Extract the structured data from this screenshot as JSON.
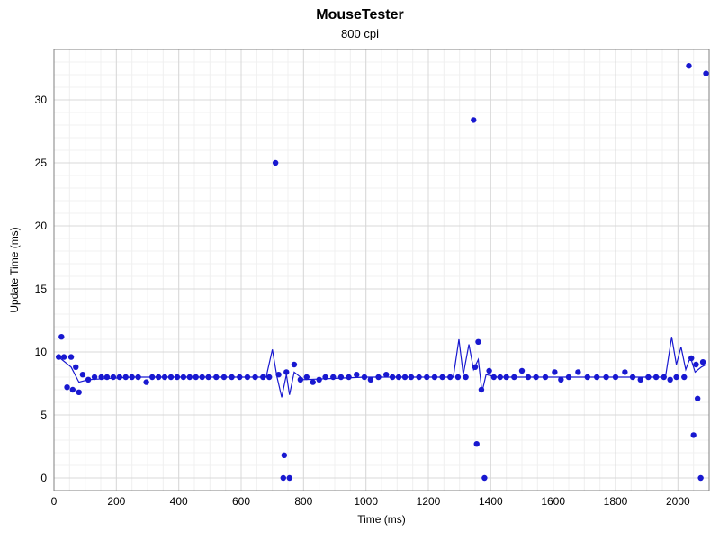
{
  "chart_data": {
    "type": "scatter",
    "title": "MouseTester",
    "subtitle": "800 cpi",
    "xlabel": "Time (ms)",
    "ylabel": "Update Time (ms)",
    "xlim": [
      0,
      2100
    ],
    "ylim": [
      -1,
      34
    ],
    "x_ticks": [
      0,
      200,
      400,
      600,
      800,
      1000,
      1200,
      1400,
      1600,
      1800,
      2000
    ],
    "y_ticks": [
      0,
      5,
      10,
      15,
      20,
      25,
      30
    ],
    "series": [
      {
        "name": "Update Time",
        "color": "#1818d0",
        "points": [
          {
            "x": 15,
            "y": 9.6
          },
          {
            "x": 24,
            "y": 11.2
          },
          {
            "x": 32,
            "y": 9.6
          },
          {
            "x": 42,
            "y": 7.2
          },
          {
            "x": 55,
            "y": 9.6
          },
          {
            "x": 60,
            "y": 7.0
          },
          {
            "x": 70,
            "y": 8.8
          },
          {
            "x": 80,
            "y": 6.8
          },
          {
            "x": 92,
            "y": 8.2
          },
          {
            "x": 110,
            "y": 7.8
          },
          {
            "x": 130,
            "y": 8.0
          },
          {
            "x": 152,
            "y": 8.0
          },
          {
            "x": 170,
            "y": 8.0
          },
          {
            "x": 190,
            "y": 8.0
          },
          {
            "x": 210,
            "y": 8.0
          },
          {
            "x": 230,
            "y": 8.0
          },
          {
            "x": 250,
            "y": 8.0
          },
          {
            "x": 270,
            "y": 8.0
          },
          {
            "x": 296,
            "y": 7.6
          },
          {
            "x": 315,
            "y": 8.0
          },
          {
            "x": 335,
            "y": 8.0
          },
          {
            "x": 355,
            "y": 8.0
          },
          {
            "x": 375,
            "y": 8.0
          },
          {
            "x": 395,
            "y": 8.0
          },
          {
            "x": 415,
            "y": 8.0
          },
          {
            "x": 435,
            "y": 8.0
          },
          {
            "x": 455,
            "y": 8.0
          },
          {
            "x": 475,
            "y": 8.0
          },
          {
            "x": 495,
            "y": 8.0
          },
          {
            "x": 520,
            "y": 8.0
          },
          {
            "x": 545,
            "y": 8.0
          },
          {
            "x": 570,
            "y": 8.0
          },
          {
            "x": 595,
            "y": 8.0
          },
          {
            "x": 620,
            "y": 8.0
          },
          {
            "x": 645,
            "y": 8.0
          },
          {
            "x": 670,
            "y": 8.0
          },
          {
            "x": 690,
            "y": 8.0
          },
          {
            "x": 710,
            "y": 25.0
          },
          {
            "x": 720,
            "y": 8.2
          },
          {
            "x": 735,
            "y": 0.0
          },
          {
            "x": 738,
            "y": 1.8
          },
          {
            "x": 745,
            "y": 8.4
          },
          {
            "x": 755,
            "y": 0.0
          },
          {
            "x": 770,
            "y": 9.0
          },
          {
            "x": 790,
            "y": 7.8
          },
          {
            "x": 810,
            "y": 8.0
          },
          {
            "x": 830,
            "y": 7.6
          },
          {
            "x": 850,
            "y": 7.8
          },
          {
            "x": 870,
            "y": 8.0
          },
          {
            "x": 895,
            "y": 8.0
          },
          {
            "x": 920,
            "y": 8.0
          },
          {
            "x": 945,
            "y": 8.0
          },
          {
            "x": 970,
            "y": 8.2
          },
          {
            "x": 995,
            "y": 8.0
          },
          {
            "x": 1015,
            "y": 7.8
          },
          {
            "x": 1040,
            "y": 8.0
          },
          {
            "x": 1065,
            "y": 8.2
          },
          {
            "x": 1085,
            "y": 8.0
          },
          {
            "x": 1105,
            "y": 8.0
          },
          {
            "x": 1125,
            "y": 8.0
          },
          {
            "x": 1145,
            "y": 8.0
          },
          {
            "x": 1170,
            "y": 8.0
          },
          {
            "x": 1195,
            "y": 8.0
          },
          {
            "x": 1220,
            "y": 8.0
          },
          {
            "x": 1245,
            "y": 8.0
          },
          {
            "x": 1270,
            "y": 8.0
          },
          {
            "x": 1295,
            "y": 8.0
          },
          {
            "x": 1320,
            "y": 8.0
          },
          {
            "x": 1345,
            "y": 28.4
          },
          {
            "x": 1350,
            "y": 8.8
          },
          {
            "x": 1355,
            "y": 2.7
          },
          {
            "x": 1360,
            "y": 10.8
          },
          {
            "x": 1370,
            "y": 7.0
          },
          {
            "x": 1380,
            "y": 0.0
          },
          {
            "x": 1395,
            "y": 8.5
          },
          {
            "x": 1410,
            "y": 8.0
          },
          {
            "x": 1430,
            "y": 8.0
          },
          {
            "x": 1450,
            "y": 8.0
          },
          {
            "x": 1475,
            "y": 8.0
          },
          {
            "x": 1500,
            "y": 8.5
          },
          {
            "x": 1520,
            "y": 8.0
          },
          {
            "x": 1545,
            "y": 8.0
          },
          {
            "x": 1575,
            "y": 8.0
          },
          {
            "x": 1605,
            "y": 8.4
          },
          {
            "x": 1625,
            "y": 7.8
          },
          {
            "x": 1650,
            "y": 8.0
          },
          {
            "x": 1680,
            "y": 8.4
          },
          {
            "x": 1710,
            "y": 8.0
          },
          {
            "x": 1740,
            "y": 8.0
          },
          {
            "x": 1770,
            "y": 8.0
          },
          {
            "x": 1800,
            "y": 8.0
          },
          {
            "x": 1830,
            "y": 8.4
          },
          {
            "x": 1855,
            "y": 8.0
          },
          {
            "x": 1880,
            "y": 7.8
          },
          {
            "x": 1905,
            "y": 8.0
          },
          {
            "x": 1930,
            "y": 8.0
          },
          {
            "x": 1955,
            "y": 8.0
          },
          {
            "x": 1975,
            "y": 7.8
          },
          {
            "x": 1995,
            "y": 8.0
          },
          {
            "x": 2020,
            "y": 8.0
          },
          {
            "x": 2035,
            "y": 32.7
          },
          {
            "x": 2043,
            "y": 9.5
          },
          {
            "x": 2050,
            "y": 3.4
          },
          {
            "x": 2058,
            "y": 9.0
          },
          {
            "x": 2063,
            "y": 6.3
          },
          {
            "x": 2073,
            "y": 0.0
          },
          {
            "x": 2080,
            "y": 9.2
          },
          {
            "x": 2090,
            "y": 32.1
          }
        ],
        "line": [
          {
            "x": 15,
            "y": 9.6
          },
          {
            "x": 55,
            "y": 8.8
          },
          {
            "x": 80,
            "y": 7.6
          },
          {
            "x": 110,
            "y": 7.8
          },
          {
            "x": 250,
            "y": 8.0
          },
          {
            "x": 500,
            "y": 8.0
          },
          {
            "x": 680,
            "y": 8.0
          },
          {
            "x": 700,
            "y": 10.2
          },
          {
            "x": 715,
            "y": 8.0
          },
          {
            "x": 730,
            "y": 6.4
          },
          {
            "x": 745,
            "y": 8.2
          },
          {
            "x": 755,
            "y": 6.6
          },
          {
            "x": 770,
            "y": 8.4
          },
          {
            "x": 800,
            "y": 7.8
          },
          {
            "x": 1000,
            "y": 8.0
          },
          {
            "x": 1280,
            "y": 8.0
          },
          {
            "x": 1298,
            "y": 11.0
          },
          {
            "x": 1312,
            "y": 8.2
          },
          {
            "x": 1330,
            "y": 10.6
          },
          {
            "x": 1345,
            "y": 8.6
          },
          {
            "x": 1360,
            "y": 9.4
          },
          {
            "x": 1372,
            "y": 6.8
          },
          {
            "x": 1385,
            "y": 8.2
          },
          {
            "x": 1420,
            "y": 8.0
          },
          {
            "x": 1700,
            "y": 8.0
          },
          {
            "x": 1960,
            "y": 8.0
          },
          {
            "x": 1980,
            "y": 11.2
          },
          {
            "x": 1995,
            "y": 9.0
          },
          {
            "x": 2010,
            "y": 10.4
          },
          {
            "x": 2025,
            "y": 8.6
          },
          {
            "x": 2040,
            "y": 9.6
          },
          {
            "x": 2055,
            "y": 8.4
          },
          {
            "x": 2075,
            "y": 8.8
          },
          {
            "x": 2090,
            "y": 9.0
          }
        ]
      }
    ]
  }
}
